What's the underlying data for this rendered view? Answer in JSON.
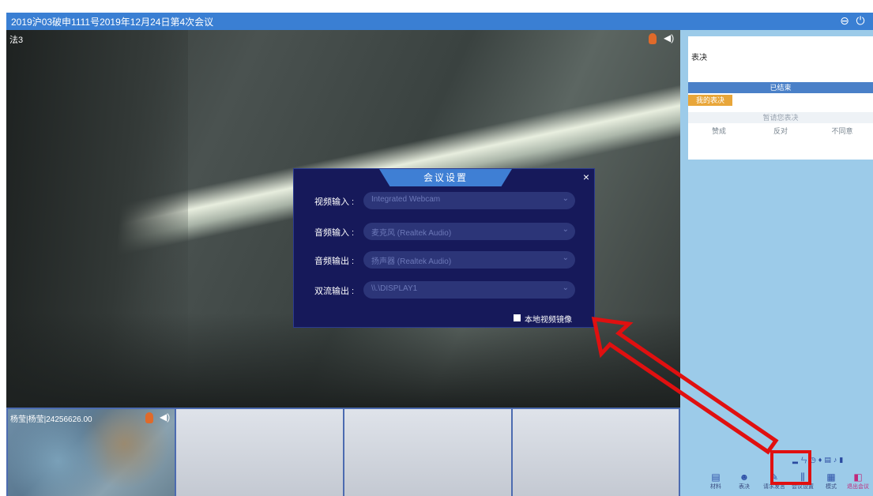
{
  "window": {
    "title": "2019沪03破申1111号2019年12月24日第4次会议",
    "minimize_icon": "minimize-icon",
    "power_icon": "power-icon"
  },
  "main_video": {
    "participant_label": "法3"
  },
  "dialog": {
    "title": "会议设置",
    "close": "×",
    "rows": [
      {
        "label": "视频输入 :",
        "value": "Integrated Webcam"
      },
      {
        "label": "音频输入 :",
        "value": "麦克风 (Realtek Audio)"
      },
      {
        "label": "音频输出 :",
        "value": "扬声器 (Realtek Audio)"
      },
      {
        "label": "双流输出 :",
        "value": "\\\\.\\DISPLAY1"
      }
    ],
    "mirror_label": "本地视频镜像",
    "mirror_checked": false
  },
  "thumbnails": [
    {
      "name": "杨莹|杨莹|24256626.00"
    },
    {
      "name": ""
    },
    {
      "name": ""
    },
    {
      "name": ""
    }
  ],
  "vote_panel": {
    "title": "表决",
    "status": "已结束",
    "tab": "我的表决",
    "note": "暂请您表决",
    "options": [
      "赞成",
      "反对",
      "不同意"
    ]
  },
  "toolbar": [
    {
      "icon": "file-icon",
      "label": "材料"
    },
    {
      "icon": "person-icon",
      "label": "表决"
    },
    {
      "icon": "edit-icon",
      "label": "请求发言"
    },
    {
      "icon": "settings-sliders-icon",
      "label": "会议设置"
    },
    {
      "icon": "layout-icon",
      "label": "模式"
    },
    {
      "icon": "exit-icon",
      "label": "退出会议"
    }
  ],
  "colors": {
    "titlebar": "#3a7fd3",
    "dialog_bg": "#16195a",
    "dialog_header": "#3f7fd4",
    "right_panel": "#9ccbe9",
    "annotation": "#e01010",
    "vote_tab": "#e8a63a"
  }
}
